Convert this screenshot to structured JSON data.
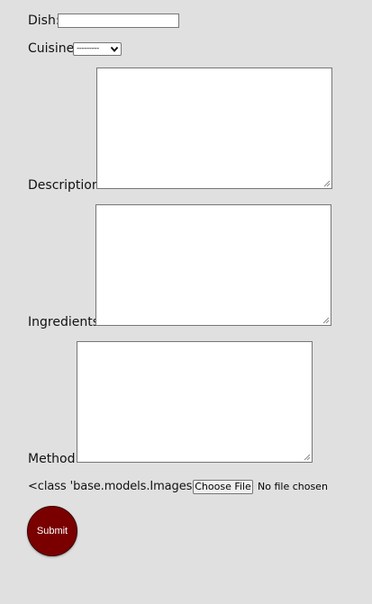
{
  "form": {
    "dish": {
      "label": "Dish:",
      "value": ""
    },
    "cuisine": {
      "label": "Cuisine:",
      "selected": "---------"
    },
    "description": {
      "label": "Description:",
      "value": ""
    },
    "ingredients": {
      "label": "Ingredients:",
      "value": ""
    },
    "method": {
      "label": "Method:",
      "value": ""
    },
    "images": {
      "label": "<class 'base.models.Images'>:",
      "button_label": "Choose File",
      "status": "No file chosen"
    },
    "submit_label": "Submit"
  },
  "colors": {
    "page_background": "#e0e0e0",
    "submit_background": "#7a0000",
    "submit_text": "#ffffff",
    "field_border": "#767676"
  },
  "icons": {
    "select_arrow": "chevron-down-icon",
    "resize_handle": "resize-grip-icon"
  }
}
